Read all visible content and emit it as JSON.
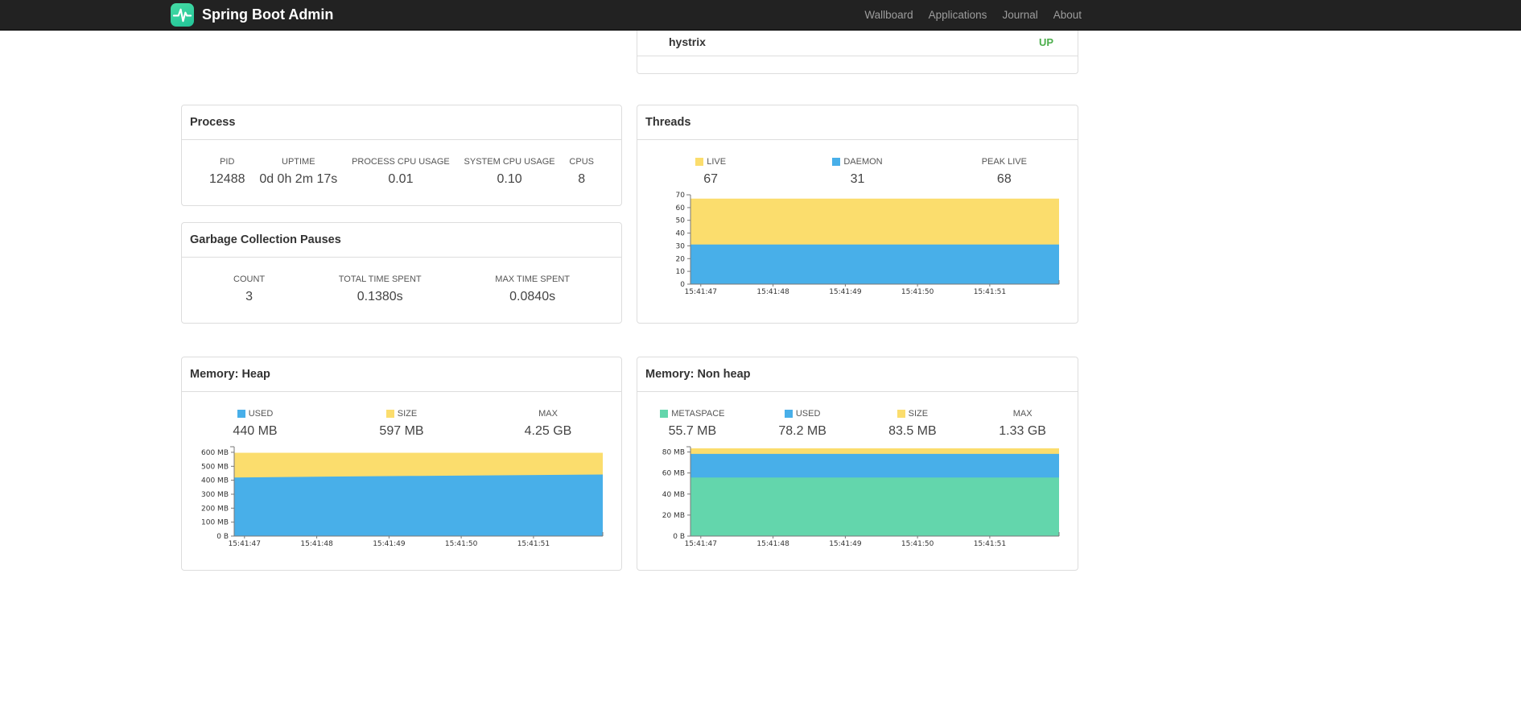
{
  "navbar": {
    "brand": "Spring Boot Admin",
    "links": [
      {
        "label": "Wallboard"
      },
      {
        "label": "Applications"
      },
      {
        "label": "Journal"
      },
      {
        "label": "About"
      }
    ]
  },
  "colors": {
    "yellow": "#FBDD6D",
    "blue": "#48AFE9",
    "green": "#63D6AC",
    "status_up": "#4CAE4C"
  },
  "status_card": {
    "rows": [
      {
        "name": "hystrix",
        "status": "UP"
      }
    ]
  },
  "process": {
    "title": "Process",
    "metrics": [
      {
        "label": "PID",
        "value": "12488"
      },
      {
        "label": "UPTIME",
        "value": "0d 0h 2m 17s"
      },
      {
        "label": "PROCESS CPU USAGE",
        "value": "0.01"
      },
      {
        "label": "SYSTEM CPU USAGE",
        "value": "0.10"
      },
      {
        "label": "CPUS",
        "value": "8"
      }
    ]
  },
  "gc": {
    "title": "Garbage Collection Pauses",
    "metrics": [
      {
        "label": "COUNT",
        "value": "3"
      },
      {
        "label": "TOTAL TIME SPENT",
        "value": "0.1380s"
      },
      {
        "label": "MAX TIME SPENT",
        "value": "0.0840s"
      }
    ]
  },
  "threads": {
    "title": "Threads",
    "metrics": [
      {
        "label": "LIVE",
        "value": "67",
        "legend": "yellow"
      },
      {
        "label": "DAEMON",
        "value": "31",
        "legend": "blue"
      },
      {
        "label": "PEAK LIVE",
        "value": "68"
      }
    ]
  },
  "memory_heap": {
    "title": "Memory: Heap",
    "metrics": [
      {
        "label": "USED",
        "value": "440 MB",
        "legend": "blue"
      },
      {
        "label": "SIZE",
        "value": "597 MB",
        "legend": "yellow"
      },
      {
        "label": "MAX",
        "value": "4.25 GB"
      }
    ]
  },
  "memory_nonheap": {
    "title": "Memory: Non heap",
    "metrics": [
      {
        "label": "METASPACE",
        "value": "55.7 MB",
        "legend": "green"
      },
      {
        "label": "USED",
        "value": "78.2 MB",
        "legend": "blue"
      },
      {
        "label": "SIZE",
        "value": "83.5 MB",
        "legend": "yellow"
      },
      {
        "label": "MAX",
        "value": "1.33 GB"
      }
    ]
  },
  "chart_data": [
    {
      "id": "threads",
      "type": "area",
      "title": "Threads",
      "xlabel": "",
      "ylabel": "",
      "x_labels": [
        "15:41:47",
        "15:41:48",
        "15:41:49",
        "15:41:50",
        "15:41:51"
      ],
      "ymax": 70,
      "y_ticks": [
        {
          "value": 0,
          "label": "0"
        },
        {
          "value": 10,
          "label": "10"
        },
        {
          "value": 20,
          "label": "20"
        },
        {
          "value": 30,
          "label": "30"
        },
        {
          "value": 40,
          "label": "40"
        },
        {
          "value": 50,
          "label": "50"
        },
        {
          "value": 60,
          "label": "60"
        },
        {
          "value": 70,
          "label": "70"
        }
      ],
      "series": [
        {
          "name": "LIVE",
          "color_key": "yellow",
          "values": [
            67,
            67,
            67,
            67,
            67
          ]
        },
        {
          "name": "DAEMON",
          "color_key": "blue",
          "values": [
            31,
            31,
            31,
            31,
            31
          ]
        }
      ]
    },
    {
      "id": "memory-heap",
      "type": "area",
      "title": "Memory: Heap",
      "xlabel": "",
      "ylabel": "",
      "x_labels": [
        "15:41:47",
        "15:41:48",
        "15:41:49",
        "15:41:50",
        "15:41:51"
      ],
      "ymax": 640,
      "y_ticks": [
        {
          "value": 0,
          "label": "0 B"
        },
        {
          "value": 100,
          "label": "100 MB"
        },
        {
          "value": 200,
          "label": "200 MB"
        },
        {
          "value": 300,
          "label": "300 MB"
        },
        {
          "value": 400,
          "label": "400 MB"
        },
        {
          "value": 500,
          "label": "500 MB"
        },
        {
          "value": 600,
          "label": "600 MB"
        }
      ],
      "series": [
        {
          "name": "SIZE",
          "color_key": "yellow",
          "values": [
            597,
            597,
            597,
            597,
            597
          ]
        },
        {
          "name": "USED",
          "color_key": "blue",
          "values": [
            420,
            426,
            431,
            436,
            441
          ]
        }
      ]
    },
    {
      "id": "memory-nonheap",
      "type": "area",
      "title": "Memory: Non heap",
      "xlabel": "",
      "ylabel": "",
      "x_labels": [
        "15:41:47",
        "15:41:48",
        "15:41:49",
        "15:41:50",
        "15:41:51"
      ],
      "ymax": 85,
      "y_ticks": [
        {
          "value": 0,
          "label": "0 B"
        },
        {
          "value": 20,
          "label": "20 MB"
        },
        {
          "value": 40,
          "label": "40 MB"
        },
        {
          "value": 60,
          "label": "60 MB"
        },
        {
          "value": 80,
          "label": "80 MB"
        }
      ],
      "series": [
        {
          "name": "SIZE",
          "color_key": "yellow",
          "values": [
            83.5,
            83.5,
            83.5,
            83.5,
            83.5
          ]
        },
        {
          "name": "USED",
          "color_key": "blue",
          "values": [
            78.2,
            78.2,
            78.2,
            78.2,
            78.2
          ]
        },
        {
          "name": "METASPACE",
          "color_key": "green",
          "values": [
            55.7,
            55.7,
            55.7,
            55.7,
            55.7
          ]
        }
      ]
    }
  ]
}
